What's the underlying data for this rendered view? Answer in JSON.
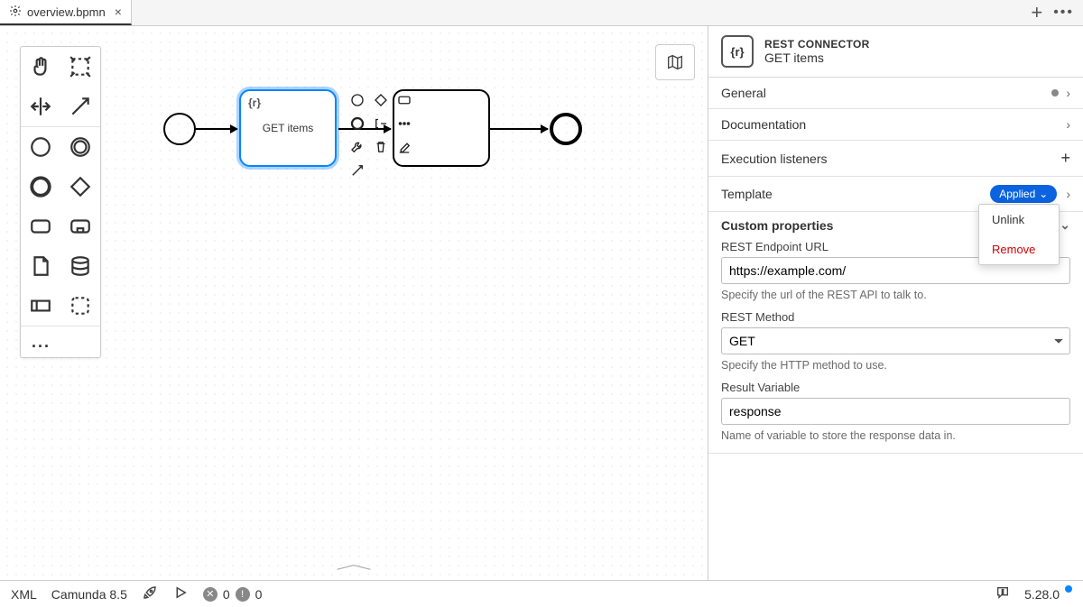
{
  "tab": {
    "filename": "overview.bpmn"
  },
  "diagram": {
    "selected_task_label": "GET items"
  },
  "props": {
    "header": {
      "type": "REST CONNECTOR",
      "name": "GET items",
      "badge": "{r}"
    },
    "sections": {
      "general": "General",
      "documentation": "Documentation",
      "execution_listeners": "Execution listeners",
      "template": "Template",
      "template_state": "Applied",
      "template_menu": {
        "unlink": "Unlink",
        "remove": "Remove"
      },
      "custom_properties": "Custom properties"
    },
    "fields": {
      "url_label": "REST Endpoint URL",
      "url_value": "https://example.com/",
      "url_hint": "Specify the url of the REST API to talk to.",
      "method_label": "REST Method",
      "method_value": "GET",
      "method_hint": "Specify the HTTP method to use.",
      "resultvar_label": "Result Variable",
      "resultvar_value": "response",
      "resultvar_hint": "Name of variable to store the response data in."
    }
  },
  "status": {
    "xml": "XML",
    "engine": "Camunda 8.5",
    "errors": "0",
    "warnings": "0",
    "version": "5.28.0"
  }
}
